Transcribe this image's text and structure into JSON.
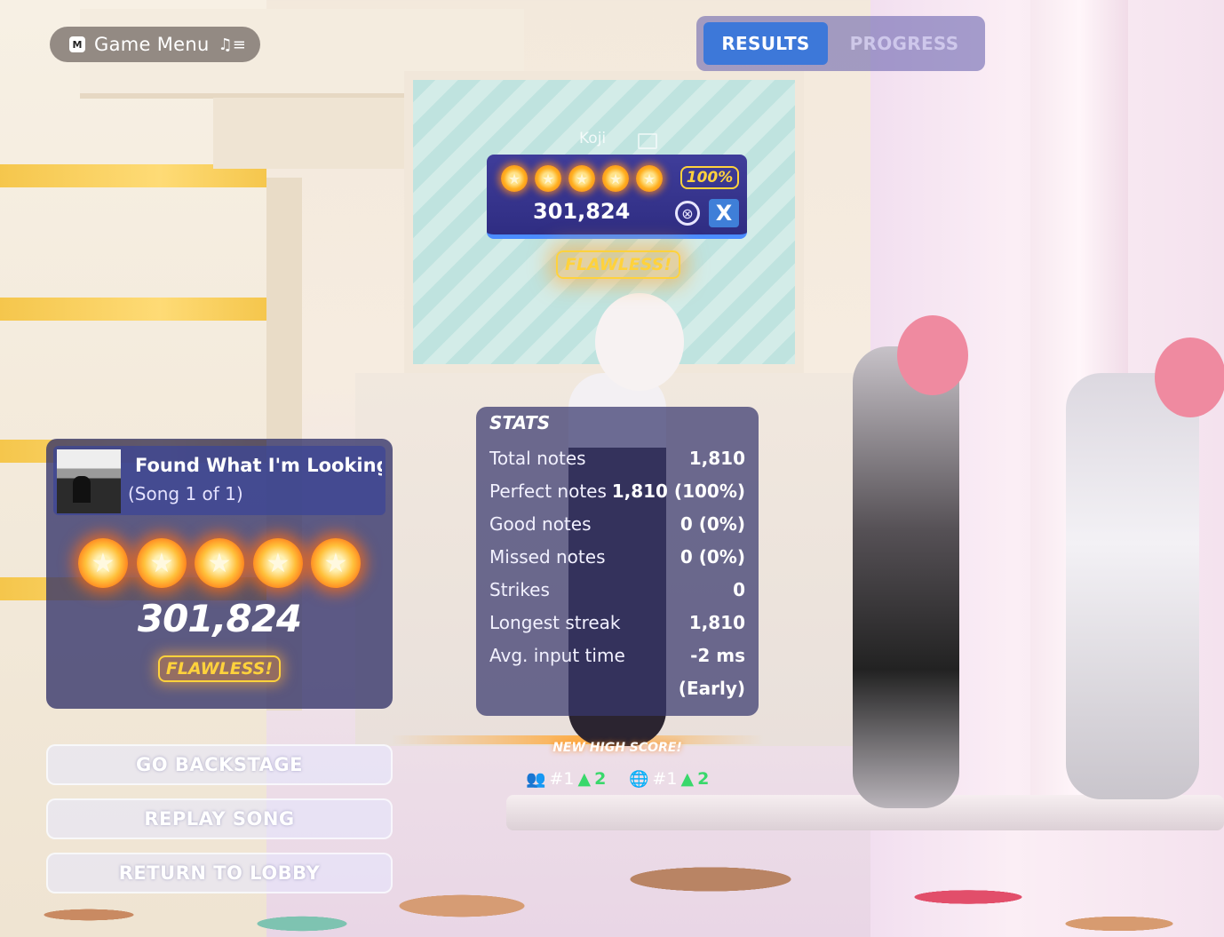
{
  "header": {
    "menu_key": "M",
    "menu_label": "Game Menu",
    "tabs": [
      "RESULTS",
      "PROGRESS"
    ]
  },
  "player": {
    "name": "Koji",
    "stars": 5,
    "percent": "100%",
    "score": "301,824",
    "instrument_button": "X",
    "rating": "FLAWLESS!"
  },
  "stats": {
    "title": "STATS",
    "rows": [
      {
        "label": "Total notes",
        "value": "1,810"
      },
      {
        "label": "Perfect notes",
        "value": "1,810 (100%)"
      },
      {
        "label": "Good notes",
        "value": "0 (0%)"
      },
      {
        "label": "Missed notes",
        "value": "0 (0%)"
      },
      {
        "label": "Strikes",
        "value": "0"
      },
      {
        "label": "Longest streak",
        "value": "1,810"
      },
      {
        "label": "Avg. input time",
        "value": "-2 ms"
      }
    ],
    "avg_extra": "(Early)"
  },
  "song": {
    "title": "Found What I'm Looking For",
    "subtitle": "(Song 1 of 1)",
    "stars": 5,
    "score": "301,824",
    "rating": "FLAWLESS!"
  },
  "actions": [
    "GO BACKSTAGE",
    "REPLAY SONG",
    "RETURN TO LOBBY"
  ],
  "high_score": {
    "label": "NEW HIGH SCORE!",
    "friends_rank": "#1",
    "friends_change": "2",
    "global_rank": "#1",
    "global_change": "2"
  },
  "colors": {
    "accent_blue": "#3d78d9",
    "gold": "#ffd23c",
    "panel": "#37376e",
    "rank_up": "#39d86b"
  },
  "icons": {
    "menu": "music-list-icon",
    "instrument": "drum-icon",
    "friends": "friends-icon",
    "global": "globe-icon",
    "star": "star-icon"
  }
}
